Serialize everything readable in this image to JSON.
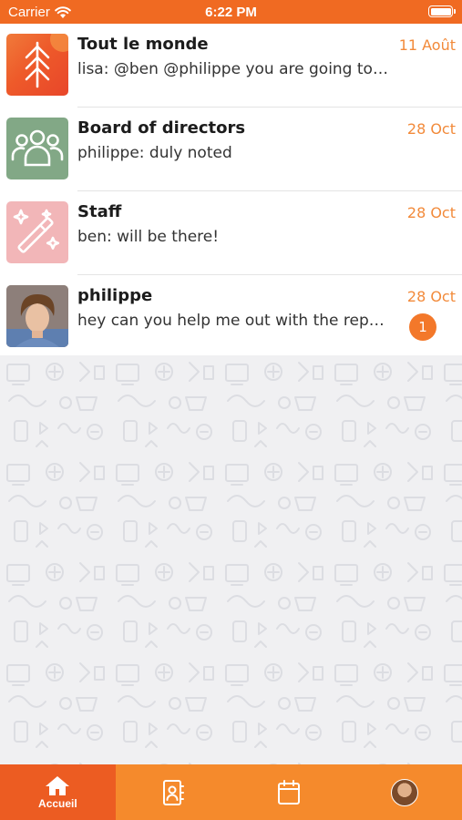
{
  "status_bar": {
    "carrier": "Carrier",
    "time": "6:22 PM",
    "icons": [
      "wifi-icon",
      "battery-icon"
    ]
  },
  "conversations": [
    {
      "title": "Tout le monde",
      "preview": "lisa: @ben @philippe you are going to li...",
      "date": "11 Août",
      "avatar": "tree-icon",
      "avatar_color": "#ee5a2a"
    },
    {
      "title": "Board of directors",
      "preview": "philippe: duly noted",
      "date": "28 Oct",
      "avatar": "group-icon",
      "avatar_color": "#82a886"
    },
    {
      "title": "Staff",
      "preview": "ben: will be there!",
      "date": "28 Oct",
      "avatar": "magic-wand-icon",
      "avatar_color": "#f2b6b8"
    },
    {
      "title": "philippe",
      "preview": "hey can you help me out with the repo...",
      "date": "28 Oct",
      "avatar": "user-photo",
      "unread": "1"
    }
  ],
  "tabbar": {
    "tabs": [
      {
        "label": "Accueil",
        "icon": "home-icon",
        "active": true
      },
      {
        "label": "",
        "icon": "contacts-icon",
        "active": false
      },
      {
        "label": "",
        "icon": "calendar-icon",
        "active": false
      },
      {
        "label": "",
        "icon": "profile-avatar",
        "active": false
      }
    ]
  },
  "colors": {
    "accent": "#f06a22",
    "tabbar": "#f58a2c",
    "tab_active": "#ec5c22",
    "date": "#f28a3a",
    "badge": "#f3782a"
  }
}
